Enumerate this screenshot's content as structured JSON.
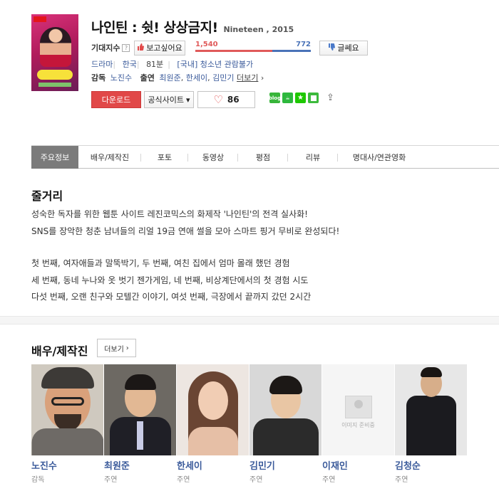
{
  "movie": {
    "title": "나인틴 : 쉿! 상상금지!",
    "sub": "Nineteen , 2015",
    "expect_label": "기대지수",
    "help_icon": "?",
    "want_label": "보고싶어요",
    "notwant_label": "글쎄요",
    "want_count": "1,540",
    "notwant_count": "772",
    "want_ratio": 0.666,
    "genre": "드라마",
    "country": "한국",
    "runtime": "81분",
    "rating": "[국내] 청소년 관람불가",
    "director_label": "감독",
    "director": "노진수",
    "cast_label": "출연",
    "cast_names": [
      "최원준",
      "한세이",
      "김민기"
    ],
    "cast_sep": ",",
    "more_label": "더보기",
    "more_arrow": "›"
  },
  "actions": {
    "download_label": "다운로드",
    "official_label": "공식사이트",
    "official_arrow": "▾",
    "like_count": "86",
    "heart_icon": "♡",
    "share": {
      "blog_label": "blog",
      "cafe_glyph": "☕",
      "star_glyph": "★",
      "share_glyph": "⇪"
    }
  },
  "tabs": [
    "주요정보",
    "배우/제작진",
    "포토",
    "동영상",
    "평점",
    "리뷰",
    "명대사/연관영화"
  ],
  "synopsis": {
    "heading": "줄거리",
    "lines": [
      "성숙한 독자를 위한 웹툰 사이트 레진코믹스의 화제작 '나인틴'의 전격 실사화!",
      " SNS를 장악한 청춘 남녀들의 리얼 19금 연애 썰을 모아 스마트 핑거 무비로 완성되다!",
      "",
      " 첫 번째, 여자애들과 말뚝박기, 두 번째, 여친 집에서 엄마 몰래 했던 경험",
      " 세 번째, 동네 누나와 옷 벗기 젠가게임, 네 번째, 비상계단에서의 첫 경험 시도",
      " 다섯 번째, 오랜 친구와 모텔간 이야기, 여섯 번째, 극장에서 끝까지 갔던 2시간"
    ]
  },
  "cast_section": {
    "heading": "배우/제작진",
    "more_label": "더보기",
    "more_arrow": "›",
    "placeholder_text": "이미지 준비중",
    "people": [
      {
        "name": "노진수",
        "role": "감독"
      },
      {
        "name": "최원준",
        "role": "주연"
      },
      {
        "name": "한세이",
        "role": "주연"
      },
      {
        "name": "김민기",
        "role": "주연"
      },
      {
        "name": "이재인",
        "role": "주연"
      },
      {
        "name": "김청순",
        "role": "주연"
      }
    ]
  },
  "colors": {
    "accent_red": "#e14848",
    "link_blue": "#3b5b9b",
    "tab_active": "#7b7b7b"
  }
}
